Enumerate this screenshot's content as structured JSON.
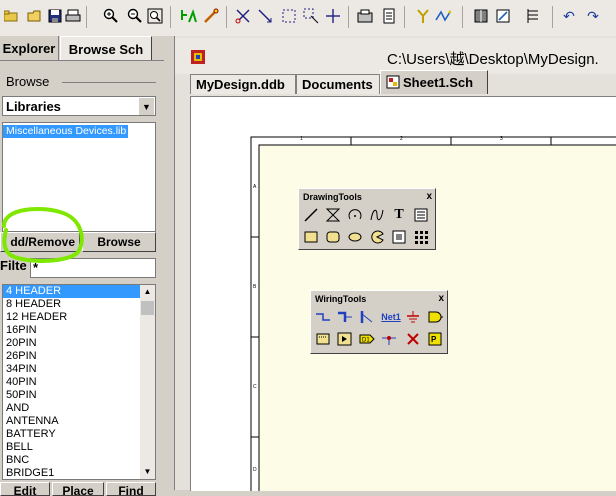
{
  "toolbar": {
    "icons": [
      "open-folder-icon",
      "save-icon",
      "print-icon",
      "zoom-in-icon",
      "zoom-out-icon",
      "zoom-fit-icon",
      "cross-probe-icon",
      "wand-icon",
      "cut-icon",
      "move-icon",
      "select-icon",
      "deselect-icon",
      "move-cross-icon",
      "library-icon",
      "hierarchy-icon",
      "probe-icon",
      "wiring-icon",
      "book-icon",
      "drawing-icon",
      "list-icon",
      "undo-icon",
      "redo-icon"
    ]
  },
  "left_panel": {
    "tabs": [
      "Explorer",
      "Browse Sch"
    ],
    "browse_label": "Browse",
    "browse_mode": "Libraries",
    "libraries": [
      "Miscellaneous Devices.lib"
    ],
    "add_remove_label": "dd/Remove",
    "browse_button_label": "Browse",
    "filter_label": "Filte",
    "filter_value": "*",
    "parts": [
      "4 HEADER",
      "8 HEADER",
      "12 HEADER",
      "16PIN",
      "20PIN",
      "26PIN",
      "34PIN",
      "40PIN",
      "50PIN",
      "AND",
      "ANTENNA",
      "BATTERY",
      "BELL",
      "BNC",
      "BRIDGE1"
    ],
    "bottom_buttons": [
      "Edit",
      "Place",
      "Find"
    ]
  },
  "editor": {
    "title_path": "C:\\Users\\越\\Desktop\\MyDesign.",
    "doc_tabs": [
      "MyDesign.ddb",
      "Documents",
      "Sheet1.Sch"
    ],
    "ruler_numbers": [
      "1",
      "2",
      "3"
    ],
    "ruler_side": [
      "A",
      "B",
      "C",
      "D"
    ]
  },
  "drawing_tools": {
    "title": "DrawingTools",
    "close": "x"
  },
  "wiring_tools": {
    "title": "WiringTools",
    "close": "x",
    "net_label": "Net1"
  },
  "colors": {
    "selection": "#3399ff",
    "sheet": "#fdfde7",
    "highlight_circle": "#7fe800"
  }
}
